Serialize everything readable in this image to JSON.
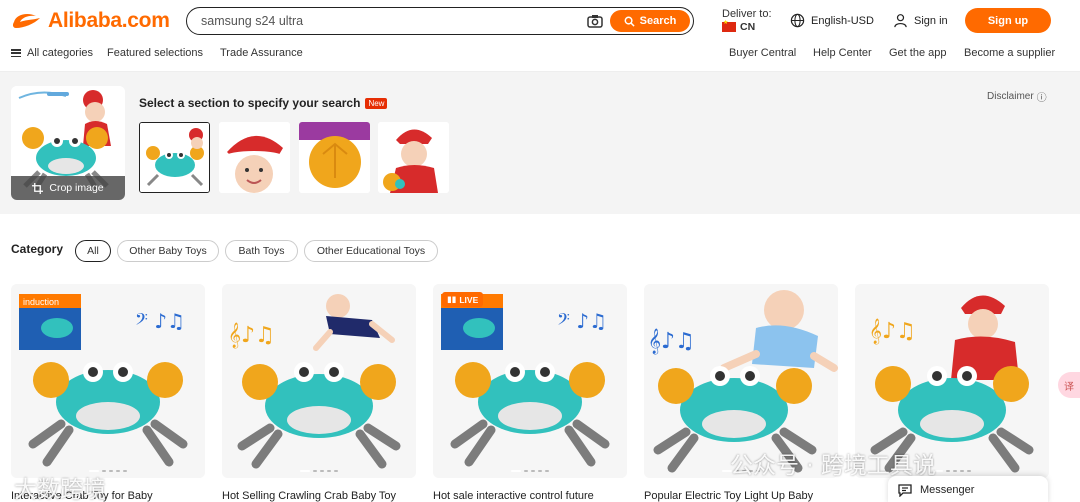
{
  "brand": {
    "logo_text": "Alibaba.com",
    "color": "#ff6a00"
  },
  "search": {
    "value": "samsung s24 ultra",
    "button_label": "Search"
  },
  "deliver": {
    "label": "Deliver to:",
    "country": "CN"
  },
  "header": {
    "language": "English-USD",
    "sign_in": "Sign in",
    "sign_up": "Sign up"
  },
  "nav_left": [
    "All categories",
    "Featured selections",
    "Trade Assurance"
  ],
  "nav_right": [
    "Buyer Central",
    "Help Center",
    "Get the app",
    "Become a supplier"
  ],
  "image_search": {
    "crop_label": "Crop image",
    "select_title": "Select a section to specify your search",
    "new_badge": "New",
    "disclaimer": "Disclaimer"
  },
  "category": {
    "label": "Category",
    "chips": [
      "All",
      "Other Baby Toys",
      "Bath Toys",
      "Other Educational Toys"
    ],
    "selected": "All"
  },
  "products": [
    {
      "title": "Interactive Crab Toy for Baby",
      "badge": "",
      "box_label": "induction"
    },
    {
      "title": "Hot Selling Crawling Crab Baby Toy",
      "badge": ""
    },
    {
      "title": "Hot sale interactive control future",
      "badge": "LIVE"
    },
    {
      "title": "Popular Electric Toy Light Up Baby",
      "badge": ""
    },
    {
      "title": "",
      "badge": ""
    }
  ],
  "messenger": {
    "label": "Messenger"
  },
  "side_tab": {
    "label": "译"
  },
  "watermarks": {
    "left": "大数跨境",
    "right": "公众号 · 跨境工具说"
  }
}
